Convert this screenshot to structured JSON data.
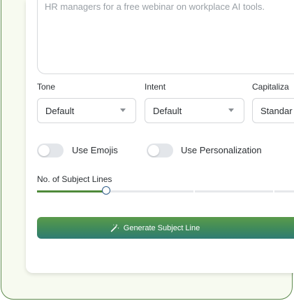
{
  "prompt": {
    "text": "HR managers for a free webinar on workplace AI tools."
  },
  "fields": {
    "tone": {
      "label": "Tone",
      "value": "Default"
    },
    "intent": {
      "label": "Intent",
      "value": "Default"
    },
    "capitalization": {
      "label": "Capitaliza",
      "value": "Standar"
    }
  },
  "toggles": {
    "emojis": {
      "label": "Use Emojis",
      "on": false
    },
    "personalization": {
      "label": "Use Personalization",
      "on": false
    }
  },
  "slider": {
    "label": "No. of Subject Lines",
    "value_fraction": 0.27
  },
  "generate_button": {
    "label": "Generate Subject Line",
    "icon": "magic-wand-icon"
  },
  "colors": {
    "accent": "#4f8a3a",
    "button_top": "#5a9a4a",
    "button_bottom": "#2f7b74",
    "frame_border": "#5e8a4e"
  }
}
